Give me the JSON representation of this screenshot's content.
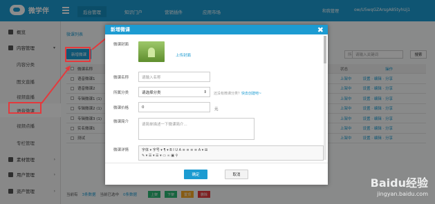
{
  "app": {
    "name": "微学伴"
  },
  "nav": {
    "tabs": [
      {
        "label": "后台管理"
      },
      {
        "label": "知识门户"
      },
      {
        "label": "营销插件"
      },
      {
        "label": "应用市场"
      }
    ],
    "user_label": "和我管理",
    "account": "ow/U5wqGZArsgA85tyhUj1"
  },
  "sidebar": {
    "items": [
      {
        "label": "概览"
      },
      {
        "label": "内容管理"
      },
      {
        "label": "内容分类"
      },
      {
        "label": "图文直播"
      },
      {
        "label": "视频直播"
      },
      {
        "label": "语音微课"
      },
      {
        "label": "视频点播"
      },
      {
        "label": "专栏管理"
      },
      {
        "label": "素材管理"
      },
      {
        "label": "用户管理"
      },
      {
        "label": "资产管理"
      }
    ]
  },
  "content": {
    "tab_label": "微课列表",
    "new_button": "新增微课",
    "filter_select": "所有状态",
    "search_placeholder": "请输入关键词",
    "search_button": "搜索",
    "table": {
      "headers": [
        "微课名称",
        "状态",
        "操作"
      ],
      "rows": [
        {
          "name": "语音微课1",
          "status": "上架中",
          "ops": "设置 · 编辑 · 分享"
        },
        {
          "name": "语音微课2",
          "status": "上架中",
          "ops": "设置 · 编辑 · 分享"
        },
        {
          "name": "专辑微课1 (1)",
          "status": "上架中",
          "ops": "设置 · 编辑 · 分享"
        },
        {
          "name": "专辑微课2 (1)",
          "status": "上架中",
          "ops": "设置 · 编辑 · 分享"
        },
        {
          "name": "专辑微课3 (1)",
          "status": "上架中",
          "ops": "设置 · 编辑 · 分享"
        },
        {
          "name": "实名微课1",
          "status": "上架中",
          "ops": "设置 · 编辑 · 分享"
        },
        {
          "name": "测试",
          "status": "上架中",
          "ops": "设置 · 编辑 · 分享"
        }
      ]
    },
    "footer": {
      "total_label": "当前有",
      "total_count": "3条数据",
      "selected_label": "当前已选中",
      "selected_count": "0条数据",
      "buttons": [
        "上架",
        "下架",
        "置顶",
        "删除"
      ]
    }
  },
  "modal": {
    "title": "新增微课",
    "close": "✖",
    "cover_label": "微课封面",
    "upload_link": "上传封面",
    "name_label": "微课名称",
    "name_placeholder": "请输入名称",
    "category_label": "所属分类",
    "category_value": "请选择分类",
    "category_hint": "还没有微课分类？",
    "category_hint_link": "快去创建吧~",
    "price_label": "微课价格",
    "price_value": "0",
    "price_unit": "元",
    "intro_label": "微课简介",
    "intro_placeholder": "请简单描述一下微课简介...",
    "detail_label": "微课详情",
    "editor_row1": "字体 ▾  字号 ▾  ¶ ▾  B  I  U  A  ≡  ≡  ≡  ≡  A ▾  ⊞",
    "editor_row2": "✎ ▾  ☰ ▾  ☰ ▾  ▭  ∞  ▣  ⚲",
    "ok_button": "确定",
    "cancel_button": "取消"
  },
  "watermark": {
    "line1": "Baidu经验",
    "line2": "jingyan.baidu.com"
  },
  "colors": {
    "primary": "#1c9bd1",
    "highlight": "#e4393c"
  }
}
